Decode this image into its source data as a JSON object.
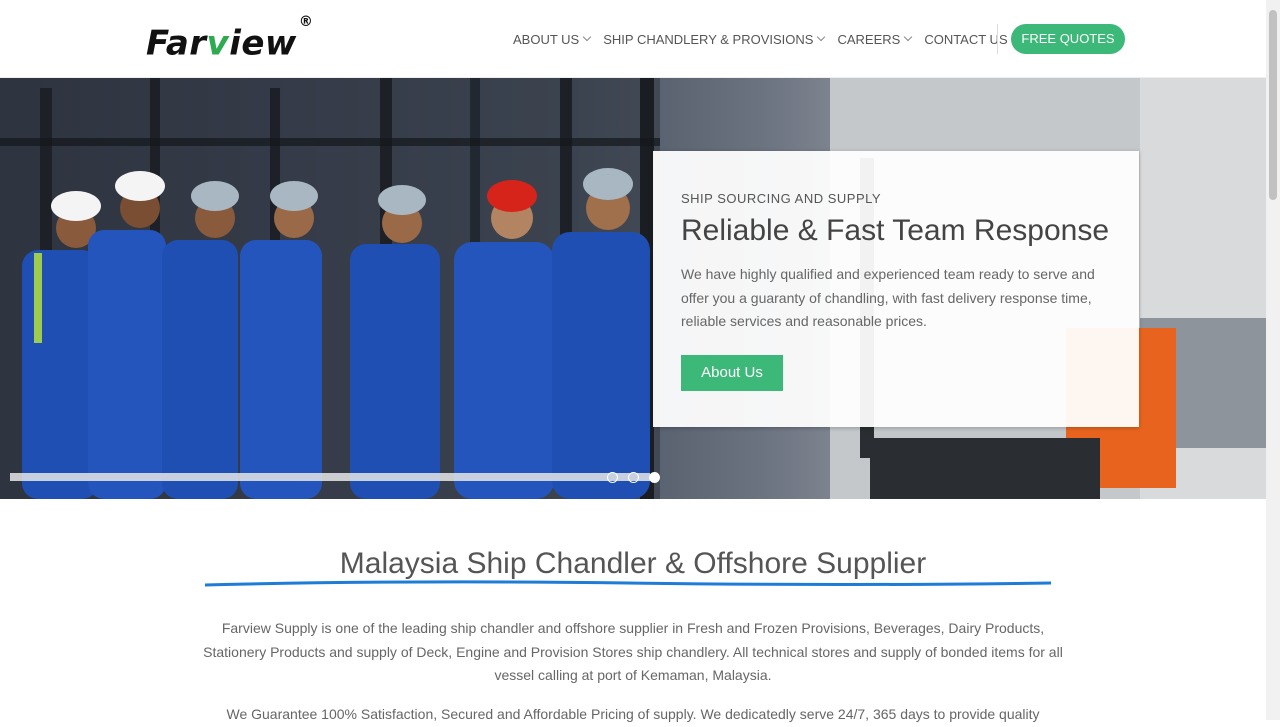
{
  "header": {
    "logo": {
      "text_start": "Far",
      "text_v": "v",
      "text_end": "iew",
      "registered": "®",
      "accent": "#2eaa50"
    },
    "nav": [
      {
        "label": "ABOUT US",
        "dropdown": true
      },
      {
        "label": "SHIP CHANDLERY & PROVISIONS",
        "dropdown": true
      },
      {
        "label": "CAREERS",
        "dropdown": true
      },
      {
        "label": "CONTACT US",
        "dropdown": false
      }
    ],
    "cta_label": "FREE QUOTES"
  },
  "hero": {
    "kicker": "SHIP SOURCING AND SUPPLY",
    "title": "Reliable & Fast Team Response",
    "text": "We have highly qualified and experienced team ready to serve and offer you a guaranty of chandling, with fast delivery response time, reliable services and reasonable prices.",
    "button_label": "About Us",
    "slides": {
      "total": 3,
      "active": 3
    }
  },
  "intro": {
    "title": "Malaysia Ship Chandler & Offshore Supplier",
    "paragraph1": "Farview Supply is one of the leading ship chandler and offshore supplier in Fresh and Frozen Provisions, Beverages, Dairy Products, Stationery Products and supply of Deck, Engine and Provision Stores ship chandlery. All technical stores and supply of bonded items for all vessel calling at port of Kemaman, Malaysia.",
    "paragraph2": "We Guarantee 100% Satisfaction, Secured and Affordable Pricing of supply. We dedicatedly serve 24/7, 365 days to provide quality"
  },
  "colors": {
    "accent_green": "#3cb878",
    "underline_blue": "#1e7bd6",
    "workwear_blue": "#1f4fb3"
  }
}
